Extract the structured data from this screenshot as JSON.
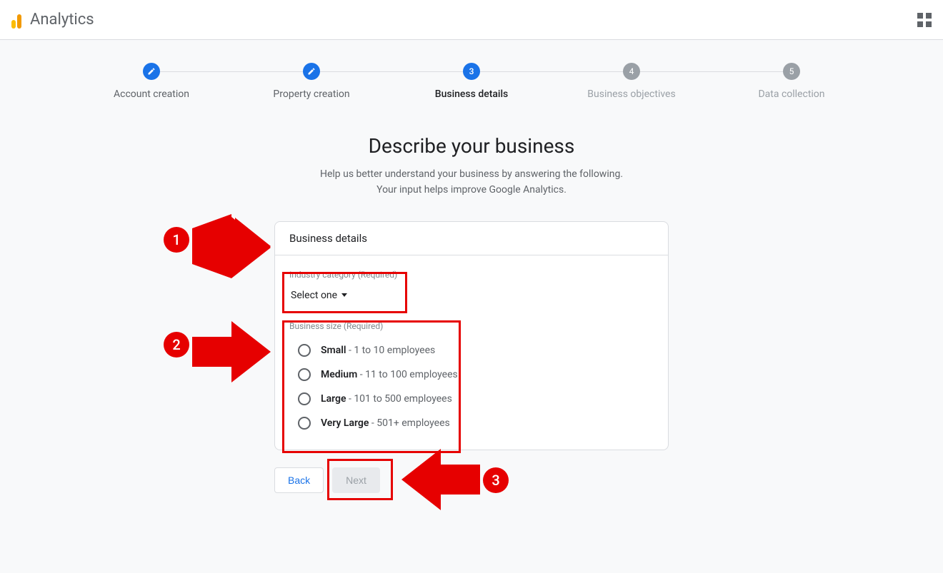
{
  "header": {
    "product": "Analytics"
  },
  "stepper": {
    "steps": [
      {
        "label": "Account creation",
        "state": "done",
        "icon": "pencil"
      },
      {
        "label": "Property creation",
        "state": "done",
        "icon": "pencil"
      },
      {
        "label": "Business details",
        "state": "current",
        "number": "3"
      },
      {
        "label": "Business objectives",
        "state": "future",
        "number": "4"
      },
      {
        "label": "Data collection",
        "state": "future",
        "number": "5"
      }
    ]
  },
  "content": {
    "headline": "Describe your business",
    "sub_line1": "Help us better understand your business by answering the following.",
    "sub_line2": "Your input helps improve Google Analytics."
  },
  "card": {
    "title": "Business details",
    "industry_label": "Industry category (Required)",
    "industry_select": "Select one",
    "size_label": "Business size (Required)",
    "sizes": [
      {
        "bold": "Small",
        "rest": " - 1 to 10 employees"
      },
      {
        "bold": "Medium",
        "rest": " - 11 to 100 employees"
      },
      {
        "bold": "Large",
        "rest": " - 101 to 500 employees"
      },
      {
        "bold": "Very Large",
        "rest": " - 501+ employees"
      }
    ]
  },
  "buttons": {
    "back": "Back",
    "next": "Next"
  },
  "annotations": {
    "n1": "1",
    "n2": "2",
    "n3": "3"
  }
}
